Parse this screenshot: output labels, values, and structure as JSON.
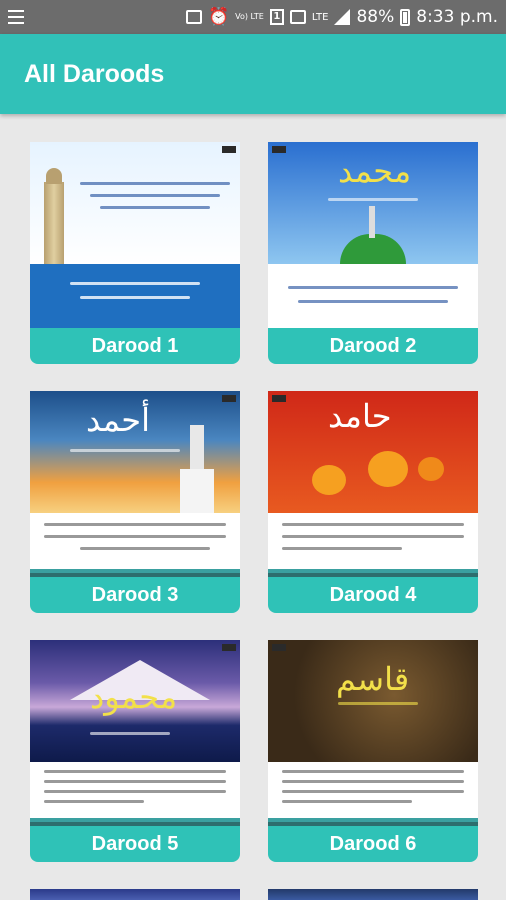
{
  "status_bar": {
    "battery": "88%",
    "time": "8:33 p.m.",
    "network": "LTE",
    "sim": "1",
    "volte": "Vo) LTE"
  },
  "app_bar": {
    "title": "All Daroods"
  },
  "cards": [
    {
      "label": "Darood 1"
    },
    {
      "label": "Darood 2"
    },
    {
      "label": "Darood 3"
    },
    {
      "label": "Darood 4"
    },
    {
      "label": "Darood 5"
    },
    {
      "label": "Darood 6"
    }
  ]
}
